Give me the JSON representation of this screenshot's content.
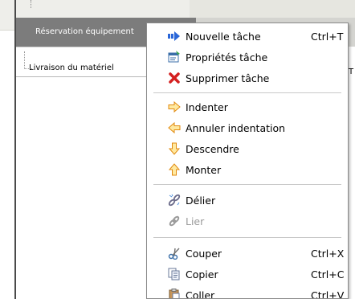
{
  "tree": {
    "rows": [
      {
        "label": "Réservation équipement"
      },
      {
        "label": "Livraison du matériel"
      }
    ],
    "edge_mark": "T"
  },
  "context_menu": {
    "groups": [
      [
        {
          "label": "Nouvelle tâche",
          "shortcut": "Ctrl+T",
          "icon": "new-task-arrow-icon",
          "enabled": true
        },
        {
          "label": "Propriétés tâche",
          "shortcut": "",
          "icon": "task-properties-icon",
          "enabled": true
        },
        {
          "label": "Supprimer tâche",
          "shortcut": "",
          "icon": "delete-x-icon",
          "enabled": true
        }
      ],
      [
        {
          "label": "Indenter",
          "shortcut": "",
          "icon": "indent-arrow-right-icon",
          "enabled": true
        },
        {
          "label": "Annuler indentation",
          "shortcut": "",
          "icon": "outdent-arrow-left-icon",
          "enabled": true
        },
        {
          "label": "Descendre",
          "shortcut": "",
          "icon": "move-down-arrow-icon",
          "enabled": true
        },
        {
          "label": "Monter",
          "shortcut": "",
          "icon": "move-up-arrow-icon",
          "enabled": true
        }
      ],
      [
        {
          "label": "Délier",
          "shortcut": "",
          "icon": "unlink-icon",
          "enabled": true
        },
        {
          "label": "Lier",
          "shortcut": "",
          "icon": "link-icon",
          "enabled": false
        }
      ],
      [
        {
          "label": "Couper",
          "shortcut": "Ctrl+X",
          "icon": "scissors-icon",
          "enabled": true
        },
        {
          "label": "Copier",
          "shortcut": "Ctrl+C",
          "icon": "copy-icon",
          "enabled": true
        },
        {
          "label": "Coller",
          "shortcut": "Ctrl+V",
          "icon": "paste-icon",
          "enabled": true
        }
      ]
    ]
  },
  "colors": {
    "selected_row": "#7c7c7c",
    "menu_border": "#8a8a8a",
    "arrow_orange": "#f0a020",
    "delete_red": "#d42020",
    "new_task_blue": "#2a66d8"
  }
}
